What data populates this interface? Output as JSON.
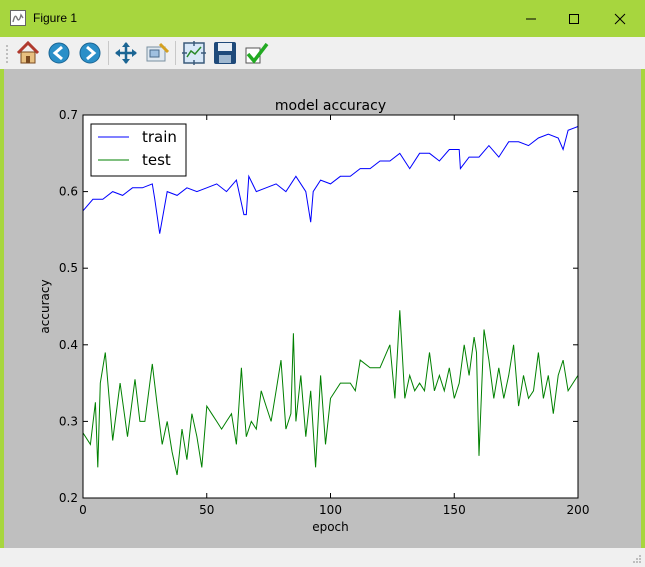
{
  "window": {
    "title": "Figure 1"
  },
  "toolbar": {
    "items": [
      {
        "name": "home-icon"
      },
      {
        "name": "back-icon"
      },
      {
        "name": "forward-icon"
      },
      {
        "name": "pan-icon"
      },
      {
        "name": "zoom-icon"
      },
      {
        "name": "subplots-icon"
      },
      {
        "name": "save-icon"
      },
      {
        "name": "edit-icon"
      }
    ]
  },
  "colors": {
    "titlebar": "#a7d63e",
    "canvas": "#bfbfbf",
    "train": "#0000ff",
    "test": "#008000"
  },
  "chart_data": {
    "type": "line",
    "title": "model accuracy",
    "xlabel": "epoch",
    "ylabel": "accuracy",
    "xlim": [
      0,
      200
    ],
    "ylim": [
      0.2,
      0.7
    ],
    "xticks": [
      "0",
      "50",
      "100",
      "150",
      "200"
    ],
    "yticks": [
      "0.2",
      "0.3",
      "0.4",
      "0.5",
      "0.6",
      "0.7"
    ],
    "legend": "upper-left",
    "series": [
      {
        "name": "train",
        "color": "#0000ff",
        "x": [
          0,
          4,
          8,
          12,
          16,
          20,
          24,
          28,
          29,
          31,
          34,
          38,
          42,
          46,
          50,
          54,
          58,
          62,
          65,
          66,
          67,
          70,
          74,
          78,
          82,
          86,
          90,
          92,
          93,
          96,
          100,
          104,
          108,
          112,
          116,
          120,
          124,
          128,
          132,
          136,
          140,
          144,
          148,
          152,
          152.5,
          156,
          160,
          164,
          168,
          172,
          176,
          180,
          184,
          188,
          192,
          194,
          196,
          200
        ],
        "y": [
          0.575,
          0.59,
          0.59,
          0.6,
          0.595,
          0.605,
          0.605,
          0.61,
          0.59,
          0.545,
          0.6,
          0.595,
          0.605,
          0.6,
          0.605,
          0.61,
          0.6,
          0.615,
          0.57,
          0.57,
          0.62,
          0.6,
          0.605,
          0.61,
          0.6,
          0.62,
          0.6,
          0.56,
          0.6,
          0.615,
          0.61,
          0.62,
          0.62,
          0.63,
          0.63,
          0.64,
          0.64,
          0.65,
          0.63,
          0.65,
          0.65,
          0.64,
          0.655,
          0.655,
          0.63,
          0.645,
          0.645,
          0.66,
          0.645,
          0.665,
          0.665,
          0.66,
          0.67,
          0.675,
          0.67,
          0.655,
          0.68,
          0.685
        ]
      },
      {
        "name": "test",
        "color": "#008000",
        "x": [
          0,
          3,
          5,
          6,
          7,
          9,
          12,
          15,
          18,
          21,
          23,
          25,
          28,
          30,
          32,
          34,
          36,
          38,
          40,
          42,
          44,
          46,
          48,
          50,
          52,
          54,
          56,
          58,
          60,
          62,
          64,
          65,
          66,
          68,
          70,
          72,
          74,
          76,
          78,
          80,
          82,
          84,
          85,
          86,
          88,
          90,
          92,
          94,
          96,
          98,
          100,
          104,
          108,
          110,
          112,
          116,
          120,
          124,
          126,
          128,
          130,
          132,
          134,
          136,
          138,
          140,
          142,
          144,
          146,
          148,
          150,
          152,
          154,
          156,
          158,
          159,
          160,
          162,
          164,
          166,
          168,
          170,
          172,
          174,
          176,
          178,
          180,
          182,
          184,
          186,
          188,
          190,
          192,
          194,
          196,
          198,
          200
        ],
        "y": [
          0.285,
          0.27,
          0.325,
          0.24,
          0.35,
          0.39,
          0.275,
          0.35,
          0.28,
          0.355,
          0.3,
          0.3,
          0.375,
          0.32,
          0.27,
          0.3,
          0.26,
          0.23,
          0.29,
          0.25,
          0.31,
          0.28,
          0.24,
          0.32,
          0.31,
          0.3,
          0.29,
          0.3,
          0.31,
          0.27,
          0.37,
          0.32,
          0.28,
          0.3,
          0.29,
          0.34,
          0.32,
          0.3,
          0.34,
          0.38,
          0.29,
          0.31,
          0.415,
          0.3,
          0.36,
          0.28,
          0.34,
          0.24,
          0.36,
          0.27,
          0.33,
          0.35,
          0.35,
          0.34,
          0.38,
          0.37,
          0.37,
          0.4,
          0.33,
          0.445,
          0.33,
          0.36,
          0.34,
          0.35,
          0.34,
          0.39,
          0.34,
          0.36,
          0.34,
          0.37,
          0.33,
          0.35,
          0.4,
          0.36,
          0.41,
          0.39,
          0.255,
          0.42,
          0.38,
          0.33,
          0.37,
          0.33,
          0.36,
          0.4,
          0.32,
          0.36,
          0.33,
          0.34,
          0.39,
          0.33,
          0.36,
          0.31,
          0.36,
          0.38,
          0.34,
          0.35,
          0.36
        ]
      }
    ]
  }
}
